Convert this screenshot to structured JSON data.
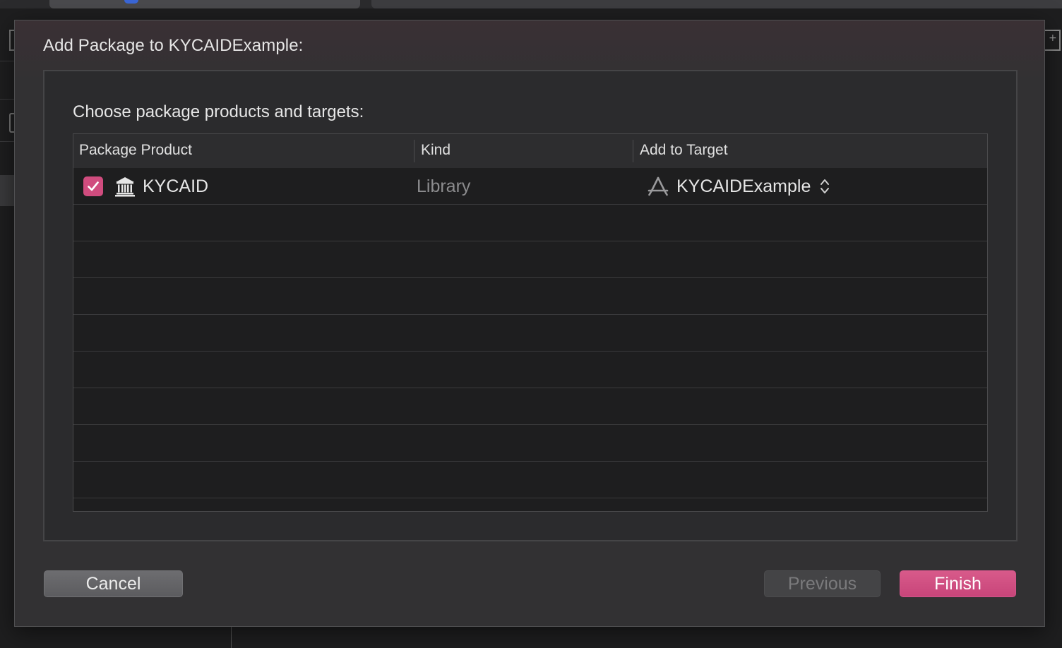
{
  "dialog": {
    "title": "Add Package to KYCAIDExample:",
    "heading": "Choose package products and targets:"
  },
  "table": {
    "columns": [
      "Package Product",
      "Kind",
      "Add to Target"
    ],
    "rows": [
      {
        "checked": true,
        "product": "KYCAID",
        "product_icon": "package-library-icon",
        "kind": "Library",
        "target": "KYCAIDExample",
        "target_icon": "app-target-icon"
      }
    ]
  },
  "buttons": {
    "cancel": "Cancel",
    "previous": "Previous",
    "finish": "Finish"
  },
  "colors": {
    "accent": "#d04c7e",
    "sheet_bg": "#323133",
    "table_bg": "#1e1e1f"
  }
}
